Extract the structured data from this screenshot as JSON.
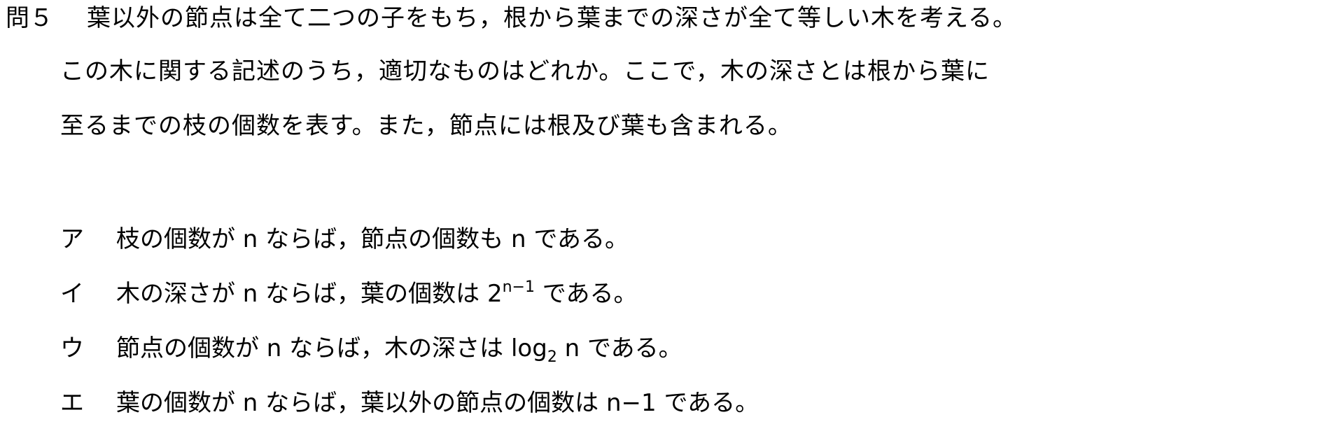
{
  "question": {
    "label": "問５",
    "lines": [
      "葉以外の節点は全て二つの子をもち，根から葉までの深さが全て等しい木を考える。",
      "この木に関する記述のうち，適切なものはどれか。ここで，木の深さとは根から葉に",
      "至るまでの枝の個数を表す。また，節点には根及び葉も含まれる。"
    ]
  },
  "choices": [
    {
      "label": "ア",
      "text": "枝の個数が n ならば，節点の個数も n である。"
    },
    {
      "label": "イ",
      "text_before": "木の深さが n ならば，葉の個数は 2",
      "superscript": "n−1",
      "text_after": " である。"
    },
    {
      "label": "ウ",
      "text_before": "節点の個数が n ならば，木の深さは log",
      "subscript": "2",
      "text_after": " n である。"
    },
    {
      "label": "エ",
      "text": "葉の個数が n ならば，葉以外の節点の個数は n−1 である。"
    }
  ]
}
